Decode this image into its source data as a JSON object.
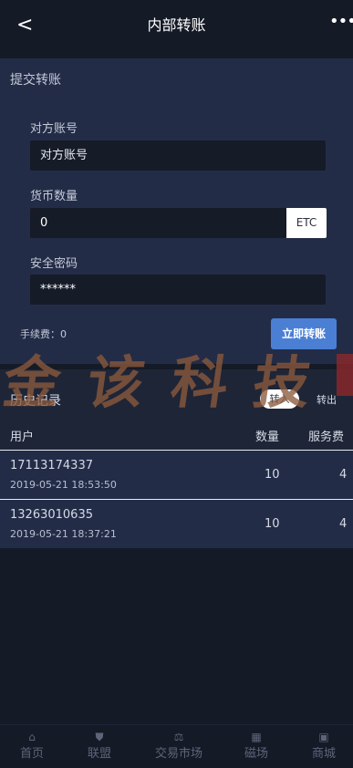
{
  "header": {
    "back_icon": "chevron-left-icon",
    "back_glyph": "<",
    "title": "内部转账",
    "more_icon": "more-dots-icon",
    "more_glyph": "•••"
  },
  "form": {
    "heading": "提交转账",
    "account_label": "对方账号",
    "account_placeholder": "对方账号",
    "quantity_label": "货币数量",
    "quantity_value": "0",
    "currency_unit": "ETC",
    "password_label": "安全密码",
    "password_value": "******",
    "fee_text": "手续费：0",
    "submit_label": "立即转账"
  },
  "history": {
    "title": "历史记录",
    "tab_in": "转入",
    "tab_out": "转出",
    "columns": {
      "user": "用户",
      "quantity": "数量",
      "fee": "服务费"
    },
    "rows": [
      {
        "user": "17113174337",
        "time": "2019-05-21 18:53:50",
        "quantity": "10",
        "fee": "4"
      },
      {
        "user": "13263010635",
        "time": "2019-05-21 18:37:21",
        "quantity": "10",
        "fee": "4"
      }
    ]
  },
  "watermark": {
    "chars": [
      "金",
      "该",
      "科",
      "技"
    ]
  },
  "nav": {
    "items": [
      {
        "label": "首页",
        "icon": "home-icon",
        "glyph": "⌂"
      },
      {
        "label": "联盟",
        "icon": "shield-icon",
        "glyph": "⛊"
      },
      {
        "label": "交易市场",
        "icon": "trade-icon",
        "glyph": "⚖"
      },
      {
        "label": "磁场",
        "icon": "field-icon",
        "glyph": "▦"
      },
      {
        "label": "商城",
        "icon": "store-icon",
        "glyph": "▣"
      }
    ]
  },
  "colors": {
    "background": "#151a27",
    "panel": "#232c47",
    "accent": "#4a7fd4"
  }
}
